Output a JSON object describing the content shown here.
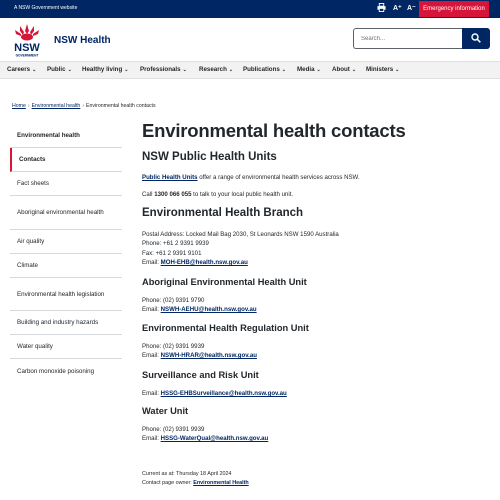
{
  "topbar": {
    "gov_label": "A NSW Government website",
    "font_up": "A⁺",
    "font_down": "A⁻",
    "emergency": "Emergency information",
    "icons": [
      "print-icon"
    ]
  },
  "header": {
    "logo_text": "NSW",
    "logo_subtext": "GOVERNMENT",
    "site_title": "NSW Health",
    "search_placeholder": "Search...",
    "icons": [
      "search-icon"
    ]
  },
  "nav": {
    "items": [
      {
        "label": "Careers"
      },
      {
        "label": "Public"
      },
      {
        "label": "Healthy living"
      },
      {
        "label": "Professionals"
      },
      {
        "label": "Research"
      },
      {
        "label": "Publications"
      },
      {
        "label": "Media"
      },
      {
        "label": "About"
      },
      {
        "label": "Ministers"
      }
    ]
  },
  "breadcrumb": {
    "home": "Home",
    "parent": "Environmental health",
    "current": "Environmental health contacts"
  },
  "sidebar": {
    "items": [
      {
        "label": "Environmental health"
      },
      {
        "label": "Contacts"
      },
      {
        "label": "Fact sheets"
      },
      {
        "label": "Aboriginal environmental health"
      },
      {
        "label": "Air quality"
      },
      {
        "label": "Climate"
      },
      {
        "label": "Environmental health legislation"
      },
      {
        "label": "Building and industry hazards"
      },
      {
        "label": "Water quality"
      },
      {
        "label": "Carbon monoxide poisoning"
      }
    ]
  },
  "main": {
    "title": "Environmental health contacts",
    "sections": {
      "public_health": {
        "heading": "NSW Public Health Units",
        "link": "Public Health Units",
        "line1_rest": " offer a range of environmental health services across NSW.",
        "line2_pre": "Call ",
        "phone": "1300 066 055",
        "line2_post": " to talk to your local public health unit."
      },
      "branch": {
        "heading": "Environmental Health Branch",
        "address": "Postal Address: Locked Mail Bag 2030, St Leonards NSW 1590 Australia",
        "phone": "Phone: +61 2 9391 9939",
        "fax": "Fax: +61 2 9391 9101",
        "email_label": "Email: ",
        "email": "MOH-EHB@health.nsw.gov.au"
      },
      "aboriginal": {
        "heading": "Aboriginal Environmental Health Unit",
        "phone": "Phone: (02) 9391 9790",
        "email_label": "Email: ",
        "email": "NSWH-AEHU@health.nsw.gov.au"
      },
      "regulation": {
        "heading": "Environmental Health Regulation Unit",
        "phone": "Phone: (02) 9391 9939",
        "email_label": "Email: ",
        "email": "NSWH-HRAR@health.nsw.gov.au"
      },
      "surveillance": {
        "heading": "Surveillance and Risk Unit",
        "email_label": "Email: ",
        "email": "HSSG-EHBSurveillance@health.nsw.gov.au"
      },
      "water": {
        "heading": "Water Unit",
        "phone": "Phone: (02) 9391 9939",
        "email_label": "Email: ",
        "email": "HSSG-WaterQual@health.nsw.gov.au"
      }
    }
  },
  "footer_meta": {
    "current_as_at": "Current as at: Thursday 18 April 2024",
    "owner_label": "Contact page owner: ",
    "owner_link": "Environmental Health"
  },
  "colors": {
    "navy": "#002664",
    "red": "#d7153a",
    "nav_bg": "#f2f2f2",
    "text": "#22272b"
  }
}
